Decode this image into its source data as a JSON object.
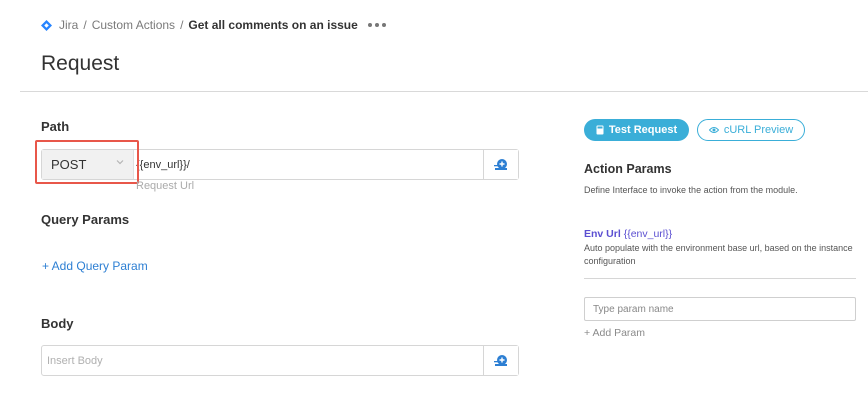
{
  "breadcrumb": {
    "icon": "jira-icon",
    "items": [
      "Jira",
      "Custom Actions"
    ],
    "current": "Get all comments on an issue",
    "separator": "/"
  },
  "page": {
    "title": "Request"
  },
  "path": {
    "label": "Path",
    "method": "POST",
    "method_options": [
      "POST"
    ],
    "url_value": "{{env_url}}/",
    "url_hint": "Request Url"
  },
  "query_params": {
    "label": "Query Params",
    "add_label": "+ Add Query Param"
  },
  "body": {
    "label": "Body",
    "placeholder": "Insert Body"
  },
  "actions": {
    "test_request": "Test Request",
    "curl_preview": "cURL Preview"
  },
  "action_params": {
    "title": "Action Params",
    "description": "Define Interface to invoke the action from the module.",
    "env_param": {
      "name": "Env Url",
      "variable": "{{env_url}}",
      "description": "Auto populate with the environment base url, based on the instance configuration"
    },
    "param_placeholder": "Type param name",
    "add_param_label": "+ Add Param"
  },
  "colors": {
    "accent": "#3aaed8",
    "link": "#2d7fd3",
    "param_name": "#5b4fd1",
    "highlight": "#e8574a"
  }
}
